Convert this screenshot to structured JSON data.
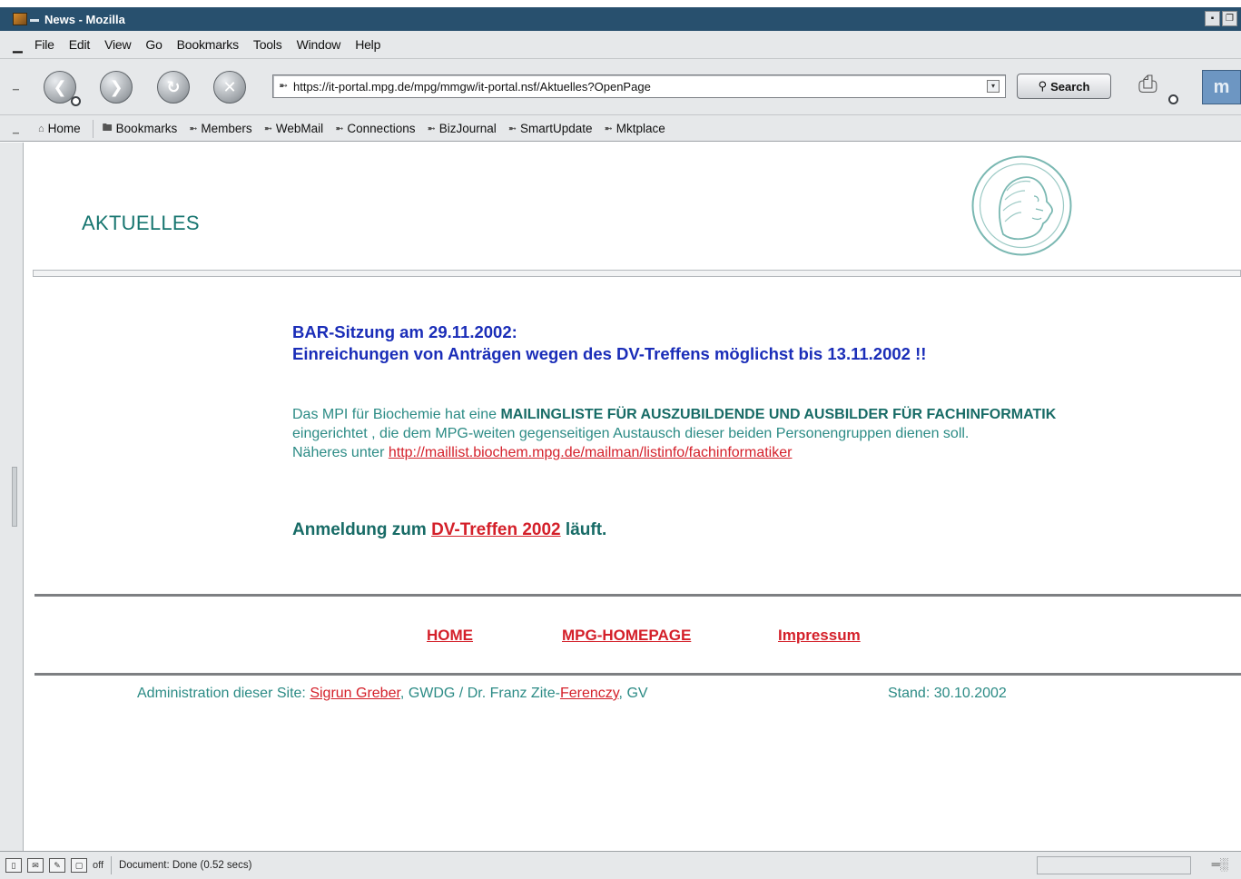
{
  "window": {
    "title": "News - Mozilla"
  },
  "menubar": {
    "items": [
      {
        "label": "File"
      },
      {
        "label": "Edit"
      },
      {
        "label": "View"
      },
      {
        "label": "Go"
      },
      {
        "label": "Bookmarks"
      },
      {
        "label": "Tools"
      },
      {
        "label": "Window"
      },
      {
        "label": "Help"
      }
    ]
  },
  "navbar": {
    "url": "https://it-portal.mpg.de/mpg/mmgw/it-portal.nsf/Aktuelles?OpenPage",
    "search_label": "Search",
    "icons": {
      "back": "back-arrow-icon",
      "forward": "forward-arrow-icon",
      "reload": "reload-icon",
      "stop": "stop-icon",
      "print": "print-icon",
      "logo": "mozilla-logo-icon"
    }
  },
  "personal_toolbar": {
    "items": [
      {
        "label": "Home"
      },
      {
        "label": "Bookmarks"
      },
      {
        "label": "Members"
      },
      {
        "label": "WebMail"
      },
      {
        "label": "Connections"
      },
      {
        "label": "BizJournal"
      },
      {
        "label": "SmartUpdate"
      },
      {
        "label": "Mktplace"
      }
    ]
  },
  "page": {
    "title": "AKTUELLES",
    "news_headline_1": "BAR-Sitzung am 29.11.2002:",
    "news_headline_2": "Einreichungen von Anträgen wegen des DV-Treffens möglichst bis 13.11.2002 !!",
    "mailing_intro": "Das MPI für Biochemie hat eine ",
    "mailing_strong": "MAILINGLISTE FÜR AUSZUBILDENDE UND AUSBILDER FÜR FACHINFORMATIK",
    "mailing_rest": " eingerichtet , die dem MPG-weiten gegenseitigen Austausch dieser beiden Personengruppen dienen soll.",
    "mailing_more": "Näheres unter ",
    "mailing_link": "http://maillist.biochem.mpg.de/mailman/listinfo/fachinformatiker",
    "anmeldung_prefix": "Anmeldung zum ",
    "anmeldung_link": "DV-Treffen 2002",
    "anmeldung_suffix": " läuft.",
    "footer_links": [
      "HOME",
      "MPG-HOMEPAGE",
      "Impressum"
    ],
    "admin_prefix": "Administration dieser Site: ",
    "admin_name_1": "Sigrun Greber",
    "admin_mid": ", GWDG / Dr. Franz Zite-",
    "admin_name_2": "Ferenczy",
    "admin_suffix": ", GV",
    "stand": "Stand: 30.10.2002"
  },
  "statusbar": {
    "off_label": "off",
    "status": "Document: Done (0.52 secs)"
  },
  "colors": {
    "teal_text": "#2b8b85",
    "dark_teal": "#176b66",
    "headline_blue": "#1a2db8",
    "link_red": "#d4202a",
    "titlebar": "#28506e"
  }
}
